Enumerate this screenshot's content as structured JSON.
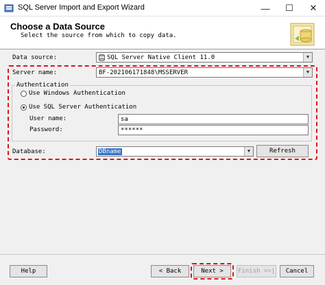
{
  "window": {
    "title": "SQL Server Import and Export Wizard",
    "minimize_glyph": "—",
    "maximize_glyph": "☐",
    "close_glyph": "✕"
  },
  "header": {
    "title": "Choose a Data Source",
    "subtitle": "Select the source from which to copy data.",
    "icon": "wizard-database-icon"
  },
  "form": {
    "data_source_label": "Data source:",
    "data_source_value": "SQL Server Native Client 11.0",
    "server_name_label": "Server name:",
    "server_name_value": "BF-202106171848\\MSSERVER",
    "auth_group_label": "Authentication",
    "auth_windows_label": "Use Windows Authentication",
    "auth_sql_label": "Use SQL Server Authentication",
    "auth_selected": "sql",
    "username_label": "User name:",
    "username_value": "sa",
    "password_label": "Password:",
    "password_value": "******",
    "database_label": "Database:",
    "database_value": "DBname",
    "refresh_label": "Refresh"
  },
  "footer": {
    "help_label": "Help",
    "back_label": "< Back",
    "next_label": "Next >",
    "finish_label": "Finish >>|",
    "cancel_label": "Cancel"
  },
  "colors": {
    "highlight": "#d8151b",
    "selection": "#3470c5"
  }
}
